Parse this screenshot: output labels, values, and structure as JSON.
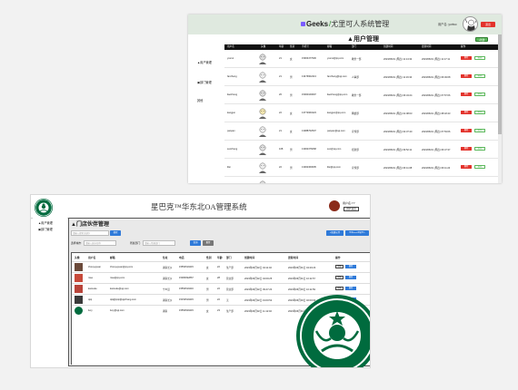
{
  "w1": {
    "brand_name": "Geeks",
    "brand_sep": "/",
    "title": "尤里可人系统管理",
    "username": "用户名: yuriwo",
    "logout": "退出",
    "sidebar": [
      {
        "label": "用户管理"
      },
      {
        "label": "部门管理"
      },
      {
        "label": "其他"
      }
    ],
    "page_title": "用户管理",
    "add_button": "+新建",
    "columns": [
      "用户名",
      "头像",
      "年龄",
      "性别",
      "手机号",
      "邮箱",
      "部门",
      "创建时间",
      "更新时间",
      "操作"
    ],
    "rows": [
      {
        "name": "yuurui",
        "age": "21",
        "sex": "女",
        "phone": "15903477900",
        "email": "yuurui@qq.com",
        "dept": "教务一部",
        "created": "2023/06/01 (周四) 11:14:32",
        "updated": "2023/06/01 (周四) 11:17:11"
      },
      {
        "name": "fanzheng",
        "age": "21",
        "sex": "男",
        "phone": "13476902413",
        "email": "fanzheng@qq.com",
        "dept": "人事部",
        "created": "2023/06/01 (周四) 11:16:34",
        "updated": "2023/06/01 (周四) 06:49:08"
      },
      {
        "name": "liaozheng",
        "age": "26",
        "sex": "男",
        "phone": "15000160697",
        "email": "liaozheng@qq.com",
        "dept": "教务一部",
        "created": "2023/06/01 (周四) 06:34:24",
        "updated": "2023/06/01 (周四) 07:57:06"
      },
      {
        "name": "kangjun",
        "age": "22",
        "sex": "女",
        "phone": "13772960423",
        "email": "kangjun@qq.com",
        "dept": "网络部",
        "created": "2023/06/01 (周四) 01:08:03",
        "updated": "2023/06/01 (周四) 08:18:43"
      },
      {
        "name": "panpan",
        "age": "21",
        "sex": "女",
        "phone": "13088762507",
        "email": "panpan@qq.com",
        "dept": "宣传部",
        "created": "2023/06/01 (周四) 02:37:40",
        "updated": "2023/06/01 (周四) 07:53:06"
      },
      {
        "name": "sunzheng",
        "age": "108",
        "sex": "男",
        "phone": "13002376068",
        "email": "sun@qq.com",
        "dept": "招新部",
        "created": "2023/06/01 (周四) 09:52:11",
        "updated": "2023/06/01 (周四) 06:47:37"
      },
      {
        "name": "lilei",
        "age": "22",
        "sex": "男",
        "phone": "13002360605",
        "email": "lilei@qq.com",
        "dept": "宣传部",
        "created": "2023/06/01 (周四) 06:11:08",
        "updated": "2023/06/01 (周四) 06:11:24"
      },
      {
        "name": "haozhineng",
        "age": "32",
        "sex": "男",
        "phone": "15002474919",
        "email": "hao@qq.com",
        "dept": "宣传部",
        "created": "2023/06/01 (周四) 06:12:47",
        "updated": "2023/06/01 (周四) 06:12:47"
      }
    ],
    "delete_label": "删除",
    "edit_label": "编辑"
  },
  "w2": {
    "title": "星巴克™华东北OA管理系统",
    "user": "用户名:YY",
    "user_btn": "用户退出",
    "sidebar": [
      {
        "label": "用户管理"
      },
      {
        "label": "部门管理"
      }
    ],
    "page_title": "门店伙伴管理",
    "search_placeholder": "请输入搜索关键字",
    "search_btn": "搜索",
    "add_btn": "+新建伙伴",
    "export_btn": "导出Excel/批量导入",
    "filter_label_1": "选择城市:",
    "filter_ph_1": "请输入城市名称",
    "filter_label_2": "所属部门:",
    "filter_ph_2": "请输入所属部门",
    "filter_btn": "查询",
    "reset_btn": "重置",
    "columns": [
      "头像",
      "用户名",
      "邮箱",
      "住址",
      "电话",
      "性别",
      "年龄",
      "部门",
      "创建时间",
      "更新时间",
      "操作"
    ],
    "rows": [
      {
        "name": "zhouyuyuan",
        "email": "zhouyuyuan@qq.com",
        "addr": "湖南长沙",
        "phone": "15552519415",
        "sex": "女",
        "age": "22",
        "dept": "生产部",
        "created": "2023年06月02日 04:11:02",
        "updated": "2023年06月01日 04:20:23"
      },
      {
        "name": "rose",
        "email": "rose@qq.com",
        "addr": "湖南长沙",
        "phone": "15384692867",
        "sex": "女",
        "age": "28",
        "dept": "营业部",
        "created": "2023年06月02日 04:09:25",
        "updated": "2023年06月01日 10:11:57"
      },
      {
        "name": "kansuke",
        "email": "kansuke@qq.com",
        "addr": "宁乡县",
        "phone": "15552519416",
        "sex": "男",
        "age": "22",
        "dept": "营业部",
        "created": "2023年06月02日 09:47:20",
        "updated": "2023年06月03日 10:11:59"
      },
      {
        "name": "qiqi",
        "email": "qiqi@qiqi@qqzhang.com",
        "addr": "湖南长沙",
        "phone": "15152519415",
        "sex": "男",
        "age": "22",
        "dept": "无",
        "created": "2023年06月02日 19:00:52",
        "updated": "2023年06月03日 02:00:00"
      },
      {
        "name": "lucy",
        "email": "lucy@qq.com",
        "addr": "湖南",
        "phone": "15552529415",
        "sex": "女",
        "age": "23",
        "dept": "生产部",
        "created": "2023年06月02日 11:12:02",
        "updated": "2023年06月01日 11:08:33"
      }
    ],
    "edit_label": "编辑",
    "delete_label": "删除"
  }
}
